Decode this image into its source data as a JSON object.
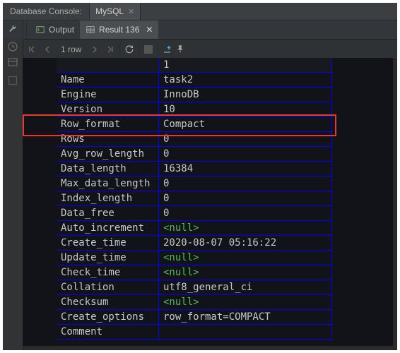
{
  "header": {
    "console_label": "Database Console:",
    "tab_label": "MySQL"
  },
  "toolbar": {
    "output_label": "Output",
    "result_label": "Result 136"
  },
  "nav": {
    "row_label": "1 row"
  },
  "tableHeader": {
    "col1": "",
    "col2": "1"
  },
  "rows": [
    {
      "k": "Name",
      "v": "task2",
      "vnull": false
    },
    {
      "k": "Engine",
      "v": "InnoDB",
      "vnull": false
    },
    {
      "k": "Version",
      "v": "10",
      "vnull": false
    },
    {
      "k": "Row_format",
      "v": "Compact",
      "vnull": false
    },
    {
      "k": "Rows",
      "v": "0",
      "vnull": false
    },
    {
      "k": "Avg_row_length",
      "v": "0",
      "vnull": false
    },
    {
      "k": "Data_length",
      "v": "16384",
      "vnull": false
    },
    {
      "k": "Max_data_length",
      "v": "0",
      "vnull": false
    },
    {
      "k": "Index_length",
      "v": "0",
      "vnull": false
    },
    {
      "k": "Data_free",
      "v": "0",
      "vnull": false
    },
    {
      "k": "Auto_increment",
      "v": "<null>",
      "vnull": true
    },
    {
      "k": "Create_time",
      "v": "2020-08-07 05:16:22",
      "vnull": false
    },
    {
      "k": "Update_time",
      "v": "<null>",
      "vnull": true
    },
    {
      "k": "Check_time",
      "v": "<null>",
      "vnull": true
    },
    {
      "k": "Collation",
      "v": "utf8_general_ci",
      "vnull": false
    },
    {
      "k": "Checksum",
      "v": "<null>",
      "vnull": true
    },
    {
      "k": "Create_options",
      "v": "row_format=COMPACT",
      "vnull": false
    },
    {
      "k": "Comment",
      "v": "",
      "vnull": false
    }
  ],
  "highlight_key": "Row_format"
}
